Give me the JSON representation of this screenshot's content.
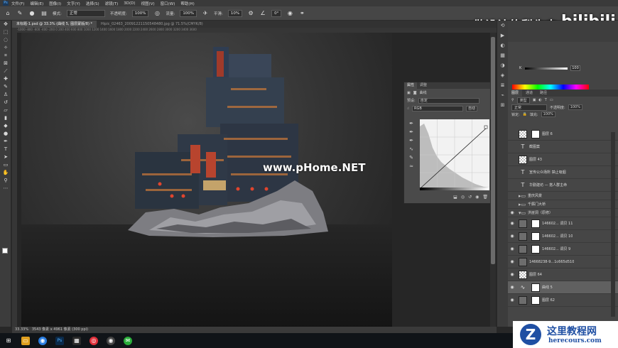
{
  "menubar": {
    "logo": "Ps",
    "items": [
      "文件(F)",
      "编辑(E)",
      "图像(I)",
      "文字(Y)",
      "选择(S)",
      "滤镜(T)",
      "3D(D)",
      "视图(V)",
      "窗口(W)",
      "帮助(H)"
    ]
  },
  "options": {
    "mode_label": "模式:",
    "mode_value": "正常",
    "opacity_label": "不透明度:",
    "opacity_value": "100%",
    "flow_label": "流量:",
    "flow_value": "100%",
    "smooth_label": "平滑:",
    "smooth_value": "10%",
    "angle_value": "0°"
  },
  "watermark": {
    "author": "做设计的梨先森",
    "platform": "bilibili",
    "site": "www.pHome.NET"
  },
  "tabs": [
    {
      "label": "未标题-1.psd @ 33.3% (曲线 5, 图层蒙版/8) *"
    },
    {
      "label": "Hipic_02463_20091221150548480.jpg @ 71.5%(CMYK/8)"
    }
  ],
  "ruler_marks": "-1000   -800   -600   -400   -200   0   200   400   600   800   1000   1200   1400   1600   1800   2000   2200   2400   2600   2800   3000   3200   3400   3600",
  "properties": {
    "tabs": [
      "属性",
      "调整"
    ],
    "title": "曲线",
    "preset_label": "预设:",
    "preset_value": "自定",
    "channel_value": "RGB",
    "auto_label": "自动"
  },
  "status": {
    "zoom": "33.33%",
    "doc": "3543 像素 x 4961 像素 (300 ppi)"
  },
  "color_panel": {
    "slider_label": "K",
    "slider_value": "100"
  },
  "layers": {
    "tabs": [
      "图层",
      "通道",
      "路径"
    ],
    "filter_label": "类型",
    "blend_value": "正常",
    "opacity_label": "不透明度:",
    "opacity_value": "100%",
    "lock_label": "锁定:",
    "fill_label": "填充:",
    "fill_value": "100%",
    "items": [
      {
        "name": "图层 6",
        "type": "pixel",
        "visible": false
      },
      {
        "name": "截图案",
        "type": "text",
        "visible": false
      },
      {
        "name": "图层 43",
        "type": "pixel",
        "visible": false
      },
      {
        "name": "宣传公众场所 禁止吸烟",
        "type": "text",
        "visible": false
      },
      {
        "name": "华勤建坊 — 搭人群主命",
        "type": "text",
        "visible": false
      },
      {
        "name": "重庆风景",
        "type": "folder",
        "visible": false
      },
      {
        "name": "千厮门大桥",
        "type": "folder",
        "visible": false
      },
      {
        "name": "洪崖洞（原修）",
        "type": "folder",
        "visible": true
      },
      {
        "name": "146602... 调贝 11",
        "type": "pixel",
        "visible": true
      },
      {
        "name": "146602... 调贝 10",
        "type": "pixel",
        "visible": true
      },
      {
        "name": "146602... 调贝 9",
        "type": "pixel",
        "visible": true
      },
      {
        "name": "14668238-9...1c665d510",
        "type": "pixel",
        "visible": true
      },
      {
        "name": "图层 64",
        "type": "pixel",
        "visible": true
      },
      {
        "name": "曲线 5",
        "type": "adjust",
        "visible": true,
        "selected": true
      },
      {
        "name": "图层 62",
        "type": "pixel",
        "visible": true
      }
    ]
  },
  "corner_logo": {
    "letter": "Z",
    "title": "这里教程网",
    "url": "herecours.com"
  }
}
